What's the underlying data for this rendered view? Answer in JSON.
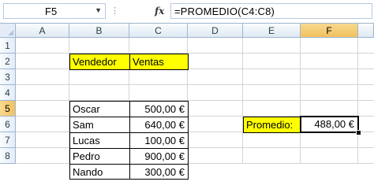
{
  "formula_bar": {
    "name_box": "F5",
    "fx_label": "fx",
    "formula": "=PROMEDIO(C4:C8)"
  },
  "columns": [
    "A",
    "B",
    "C",
    "D",
    "E",
    "F"
  ],
  "rows": [
    "1",
    "2",
    "3",
    "4",
    "5",
    "6",
    "7",
    "8"
  ],
  "selected_cell": "F5",
  "table": {
    "header": {
      "vendedor": "Vendedor",
      "ventas": "Ventas"
    },
    "rows": [
      {
        "name": "Oscar",
        "value": "500,00 €"
      },
      {
        "name": "Sam",
        "value": "640,00 €"
      },
      {
        "name": "Lucas",
        "value": "100,00 €"
      },
      {
        "name": "Pedro",
        "value": "900,00 €"
      },
      {
        "name": "Nando",
        "value": "300,00 €"
      }
    ]
  },
  "average": {
    "label": "Promedio:",
    "value": "488,00 €"
  },
  "colors": {
    "highlight": "#ffff00",
    "header_active": "#f1c05f"
  }
}
